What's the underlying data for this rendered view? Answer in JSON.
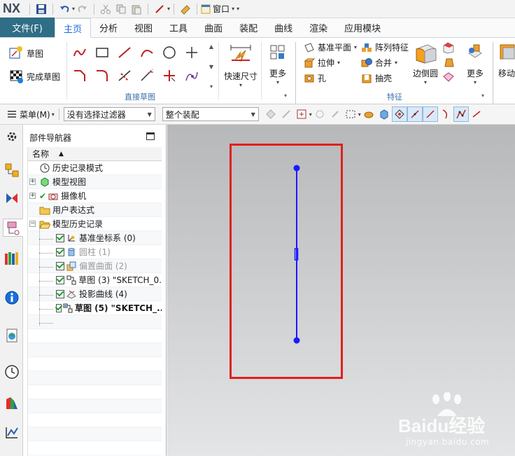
{
  "app": {
    "logo": "NX",
    "window_menu": "窗口"
  },
  "tabs": {
    "file": "文件(F)",
    "items": [
      "主页",
      "分析",
      "视图",
      "工具",
      "曲面",
      "装配",
      "曲线",
      "渲染",
      "应用模块"
    ],
    "active": "主页"
  },
  "ribbon": {
    "sketch_btn": "草图",
    "finish_sketch_btn": "完成草图",
    "quick_dim": "快速尺寸",
    "more": "更多",
    "direct_sketch_group": "直接草图",
    "datum_plane": "基准平面",
    "extrude": "拉伸",
    "hole": "孔",
    "pattern_feature": "阵列特征",
    "combine": "合并",
    "shell": "抽壳",
    "edge_blend": "边倒圆",
    "more2": "更多",
    "feature_group": "特征",
    "move": "移动"
  },
  "selection_bar": {
    "menu": "菜单(M)",
    "filter": "没有选择过滤器",
    "scope": "整个装配"
  },
  "navigator": {
    "title": "部件导航器",
    "column": "名称",
    "rows": [
      {
        "label": "历史记录模式",
        "icon": "clock-icon",
        "level": 0
      },
      {
        "label": "模型视图",
        "icon": "model-views-icon",
        "level": 0,
        "expander": "+"
      },
      {
        "label": "摄像机",
        "icon": "camera-icon",
        "level": 0,
        "expander": "+"
      },
      {
        "label": "用户表达式",
        "icon": "folder-icon",
        "level": 0
      },
      {
        "label": "模型历史记录",
        "icon": "folder-open-icon",
        "level": 0,
        "expander": "−"
      },
      {
        "label": "基准坐标系 (0)",
        "icon": "datum-csys-icon",
        "level": 1
      },
      {
        "label": "圆柱 (1)",
        "icon": "cylinder-icon",
        "level": 1,
        "dim": true
      },
      {
        "label": "偏置曲面 (2)",
        "icon": "offset-surface-icon",
        "level": 1,
        "dim": true
      },
      {
        "label": "草图 (3) \"SKETCH_0.",
        "icon": "sketch-icon",
        "level": 1
      },
      {
        "label": "投影曲线 (4)",
        "icon": "project-curve-icon",
        "level": 1
      },
      {
        "label": "草图 (5) \"SKETCH_..",
        "icon": "sketch-active-icon",
        "level": 1,
        "bold": true
      }
    ]
  },
  "watermark": {
    "brand": "Baidu经验",
    "url": "jingyan.baidu.com"
  },
  "colors": {
    "file_tab": "#2f6e86",
    "active_tab_text": "#1a6ed8",
    "sketch_line": "#1a1aff",
    "highlight": "#e0201e"
  }
}
